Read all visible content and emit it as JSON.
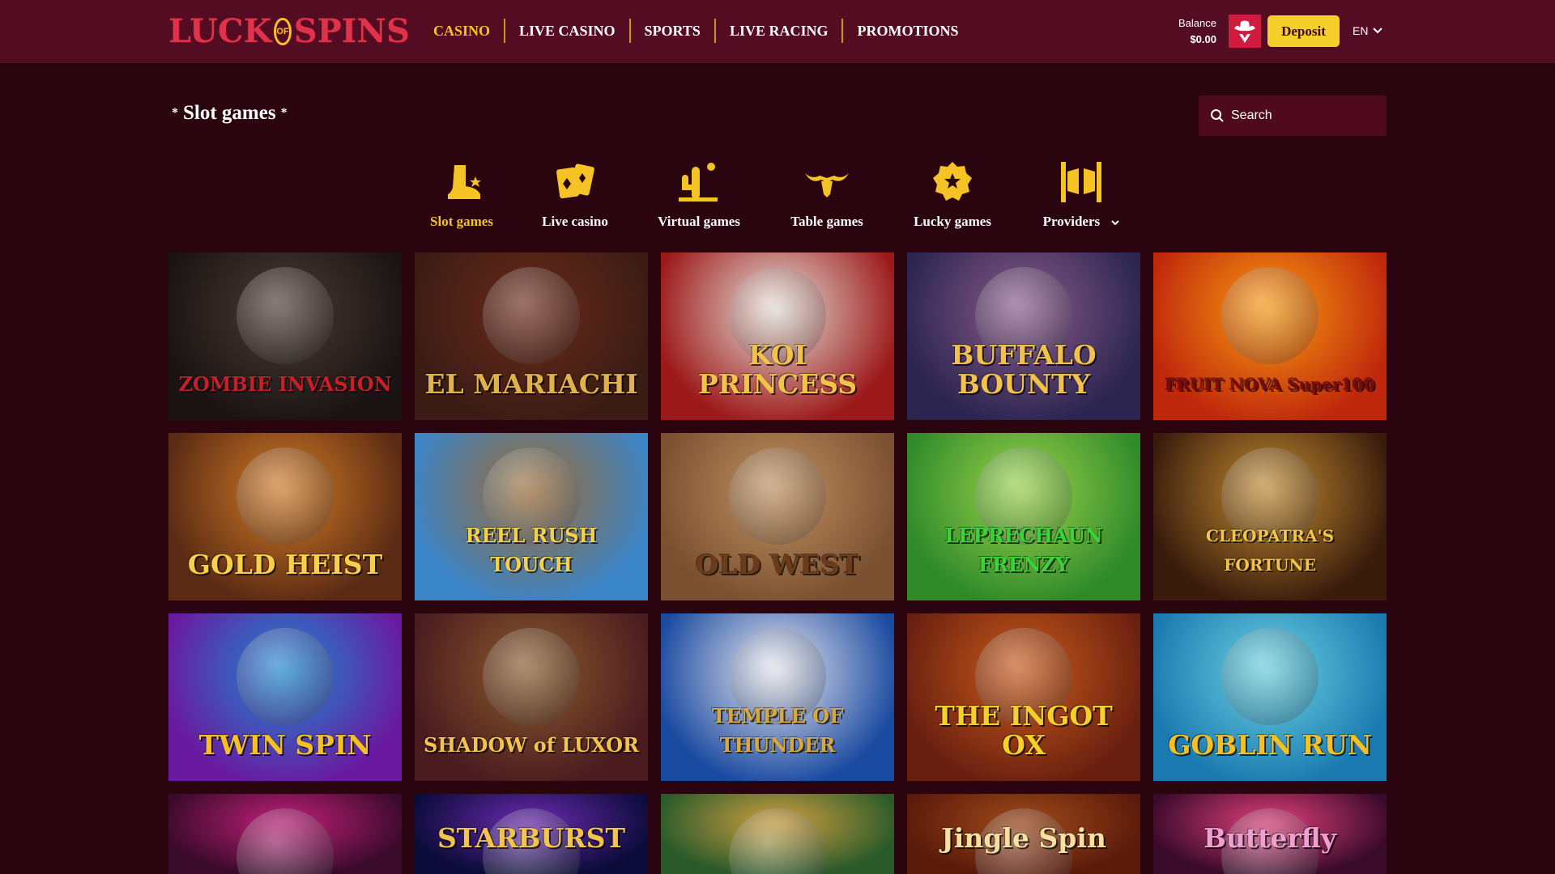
{
  "header": {
    "logo": {
      "part1": "LUCK",
      "part2": "OF",
      "part3": "SPINS"
    },
    "nav": [
      {
        "label": "CASINO",
        "active": true
      },
      {
        "label": "LIVE CASINO",
        "active": false
      },
      {
        "label": "SPORTS",
        "active": false
      },
      {
        "label": "LIVE RACING",
        "active": false
      },
      {
        "label": "PROMOTIONS",
        "active": false
      }
    ],
    "balance_label": "Balance",
    "balance_amount": "$0.00",
    "deposit_label": "Deposit",
    "language": "EN"
  },
  "page": {
    "star_left": "*",
    "title": "Slot games",
    "star_right": "*",
    "search_placeholder": "Search"
  },
  "categories": [
    {
      "label": "Slot games",
      "icon": "boot-icon",
      "active": true
    },
    {
      "label": "Live casino",
      "icon": "cards-icon",
      "active": false
    },
    {
      "label": "Virtual games",
      "icon": "cactus-icon",
      "active": false
    },
    {
      "label": "Table games",
      "icon": "bull-horns-icon",
      "active": false
    },
    {
      "label": "Lucky games",
      "icon": "sheriff-badge-icon",
      "active": false
    },
    {
      "label": "Providers",
      "icon": "saloon-doors-icon",
      "active": false,
      "dropdown": true
    }
  ],
  "games": [
    {
      "title": "ZOMBIE INVASION",
      "bg": [
        "#1a1414",
        "#4b3a33"
      ],
      "fg": "#c81e2a"
    },
    {
      "title": "EL MARIACHI",
      "bg": [
        "#3a1c14",
        "#6b2a1a"
      ],
      "fg": "#e0b24c"
    },
    {
      "title": "KOI PRINCESS",
      "bg": [
        "#9c1a1a",
        "#e7e0d8"
      ],
      "fg": "#f2c24a"
    },
    {
      "title": "BUFFALO BOUNTY",
      "bg": [
        "#2b2550",
        "#8a5a8a"
      ],
      "fg": "#f1c14a"
    },
    {
      "title": "FRUIT NOVA Super100",
      "bg": [
        "#c0280c",
        "#f89a10"
      ],
      "fg": "#7a0a10"
    },
    {
      "title": "GOLD HEIST",
      "bg": [
        "#5a2a14",
        "#d07a24"
      ],
      "fg": "#f6d04a"
    },
    {
      "title": "REEL RUSH TOUCH",
      "bg": [
        "#3a84c8",
        "#9c6a30"
      ],
      "fg": "#f2d04c"
    },
    {
      "title": "OLD WEST",
      "bg": [
        "#7a5030",
        "#c09060"
      ],
      "fg": "#6a3c1c"
    },
    {
      "title": "LEPRECHAUN FRENZY",
      "bg": [
        "#2f8a2a",
        "#9ad24a"
      ],
      "fg": "#3ad43a"
    },
    {
      "title": "CLEOPATRA'S FORTUNE",
      "bg": [
        "#3a1c0c",
        "#c08a30"
      ],
      "fg": "#f2c44c"
    },
    {
      "title": "TWIN SPIN",
      "bg": [
        "#6a1aa0",
        "#1a8ad0"
      ],
      "fg": "#f6c024"
    },
    {
      "title": "SHADOW of LUXOR",
      "bg": [
        "#4a1c20",
        "#8a5a2a"
      ],
      "fg": "#f2c44c"
    },
    {
      "title": "TEMPLE OF THUNDER",
      "bg": [
        "#1a4aa0",
        "#e8e8f0"
      ],
      "fg": "#d8a840"
    },
    {
      "title": "THE INGOT OX",
      "bg": [
        "#6a2010",
        "#c85a1a"
      ],
      "fg": "#f6d02a"
    },
    {
      "title": "GOBLIN RUN",
      "bg": [
        "#1a7ab0",
        "#6ad0e0"
      ],
      "fg": "#f6c024"
    },
    {
      "title": "",
      "bg": [
        "#3a0a2a",
        "#c0207a"
      ],
      "fg": "#ffffff"
    },
    {
      "title": "STARBURST",
      "bg": [
        "#0c0c3a",
        "#6a2ab0"
      ],
      "fg": "#f2c44c"
    },
    {
      "title": "",
      "bg": [
        "#2a5a2a",
        "#d0a040"
      ],
      "fg": "#ffffff"
    },
    {
      "title": "Jingle Spin",
      "bg": [
        "#5a1a0a",
        "#a04a1a"
      ],
      "fg": "#f6e0a0"
    },
    {
      "title": "Butterfly",
      "bg": [
        "#3a0a2a",
        "#e0407a"
      ],
      "fg": "#f0a0d0"
    }
  ]
}
